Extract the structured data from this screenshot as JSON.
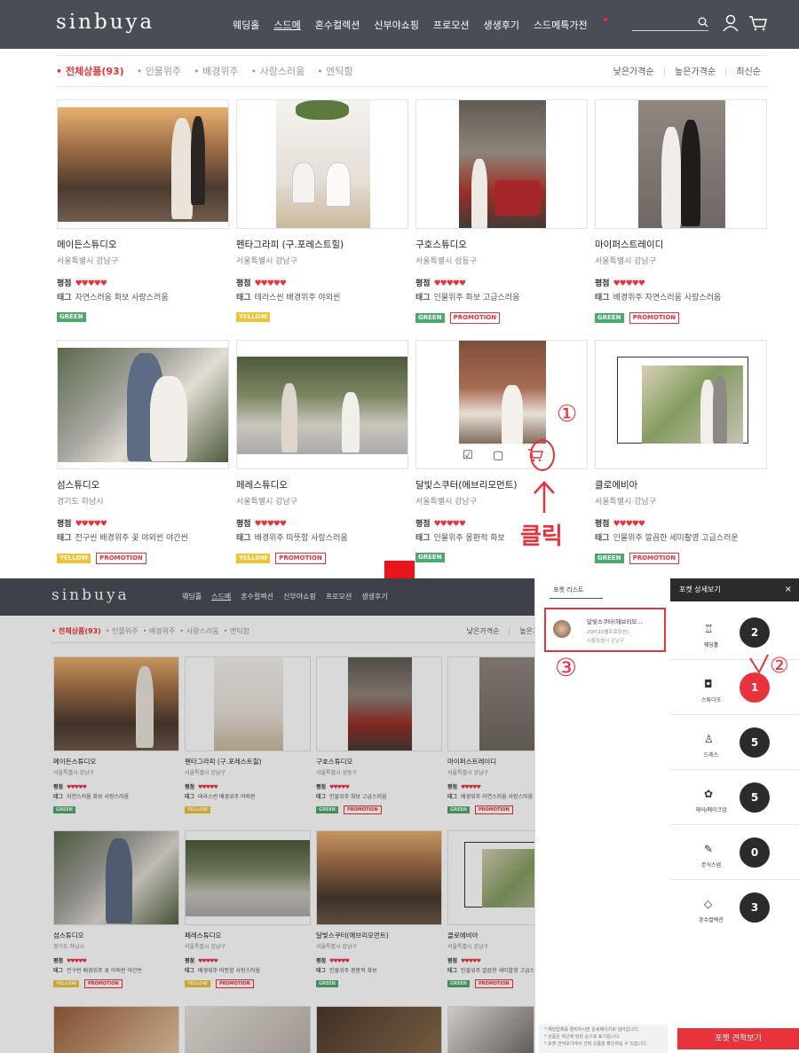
{
  "top": {
    "logo": "sinbuya",
    "nav": [
      "웨딩홀",
      "스드메",
      "혼수컬렉션",
      "신부야쇼핑",
      "프로모션",
      "생생후기",
      "스드메특가전"
    ],
    "filters": [
      "• 전체상품(93)",
      "• 인물위주",
      "• 배경위주",
      "• 사랑스러움",
      "• 엔틱함"
    ],
    "sort": [
      "낮은가격순",
      "높은가격순",
      "최신순"
    ],
    "rating_label": "평점",
    "tag_label": "태그",
    "cards": [
      {
        "name": "메이든스튜디오",
        "loc": "서울특별시 강남구",
        "hearts": "♥♥♥♥♥",
        "tags": "자연스러움 화보 사랑스러움",
        "badges": [
          "GREEN"
        ]
      },
      {
        "name": "펜타그라피 (구.포레스트힐)",
        "loc": "서울특별시 강남구",
        "hearts": "♥♥♥♥♥",
        "tags": "테라스씬 배경위주 야외씬",
        "badges": [
          "YELLOW"
        ]
      },
      {
        "name": "구호스튜디오",
        "loc": "서울특별시 성동구",
        "hearts": "♥♥♥♥♥",
        "tags": "인물위주 화보 고급스러움",
        "badges": [
          "GREEN",
          "PROMOTION"
        ]
      },
      {
        "name": "마이퍼스트레이디",
        "loc": "서울특별시 강남구",
        "hearts": "♥♥♥♥♥",
        "tags": "배경위주 자연스러움 사랑스러움",
        "badges": [
          "GREEN",
          "PROMOTION"
        ]
      },
      {
        "name": "섬스튜디오",
        "loc": "경기도 하남시",
        "hearts": "♥♥♥♥♥",
        "tags": "전구씬 배경위주 꽃 야외씬 야간씬",
        "badges": [
          "YELLOW",
          "PROMOTION"
        ]
      },
      {
        "name": "페레스튜디오",
        "loc": "서울특별시 강남구",
        "hearts": "♥♥♥♥♥",
        "tags": "배경위주 따뜻함 사랑스러움",
        "badges": [
          "YELLOW",
          "PROMOTION"
        ]
      },
      {
        "name": "달빛스쿠터(에브리모먼트)",
        "loc": "서울특별시 강남구",
        "hearts": "♥♥♥♥♥",
        "tags": "인물위주 몽환적 화보",
        "badges": [
          "GREEN"
        ]
      },
      {
        "name": "클로에비아",
        "loc": "서울특별시 강남구",
        "hearts": "♥♥♥♥♥",
        "tags": "인물위주 깔끔한 세미촬영 고급스러운",
        "badges": [
          "GREEN",
          "PROMOTION"
        ]
      }
    ]
  },
  "annotations": {
    "one": "①",
    "two": "②",
    "three": "③",
    "click": "클릭"
  },
  "bottom": {
    "pocket_list_title": "포켓 리스트",
    "pocket_item": {
      "name": "달빛스쿠터(에브리모...",
      "promo": "20P[10월프로모션]",
      "loc": "서울특별시 강남구"
    },
    "panel_title": "포켓 상세보기",
    "close": "×",
    "categories": [
      {
        "label": "웨딩홀",
        "icon": "♖",
        "count": "2"
      },
      {
        "label": "스튜디오",
        "icon": "◘",
        "count": "1"
      },
      {
        "label": "드레스",
        "icon": "♙",
        "count": "5"
      },
      {
        "label": "헤어/메이크업",
        "icon": "✿",
        "count": "5"
      },
      {
        "label": "본식스냅",
        "icon": "✎",
        "count": "0"
      },
      {
        "label": "혼수컬렉션",
        "icon": "◇",
        "count": "3"
      }
    ],
    "notes": [
      "* 해당업체를 클릭하시면 상세페이지로 넘어갑니다.",
      "* 상품은 최근에 담은 순으로 표기됩니다.",
      "* 포켓 견적보기에서 선택 상품을 확인하실 수 있습니다."
    ],
    "estimate_button": "포켓 견적보기"
  }
}
